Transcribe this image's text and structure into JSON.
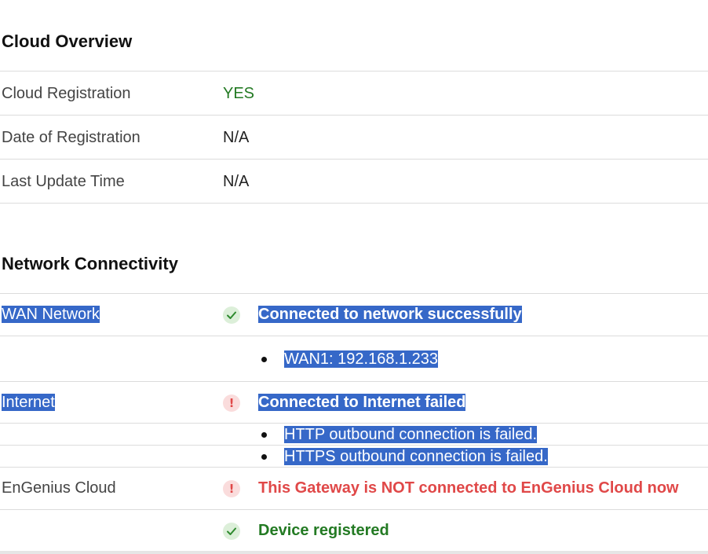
{
  "cloud_overview": {
    "title": "Cloud Overview",
    "rows": [
      {
        "label": "Cloud Registration",
        "value": "YES",
        "value_color": "#237a23"
      },
      {
        "label": "Date of Registration",
        "value": "N/A"
      },
      {
        "label": "Last Update Time",
        "value": "N/A"
      }
    ]
  },
  "network_connectivity": {
    "title": "Network Connectivity",
    "wan": {
      "label": "WAN Network",
      "status": "ok",
      "status_icon": "check-icon",
      "status_text": "Connected to network successfully",
      "details": [
        "WAN1: 192.168.1.233"
      ]
    },
    "internet": {
      "label": "Internet",
      "status": "error",
      "status_icon": "exclamation-icon",
      "status_text": "Connected to Internet failed",
      "details": [
        "HTTP outbound connection is failed.",
        "HTTPS outbound connection is failed."
      ]
    },
    "engenius_cloud": {
      "label": "EnGenius Cloud",
      "status": "error",
      "status_icon": "exclamation-icon",
      "status_text": "This Gateway is NOT connected to EnGenius Cloud now",
      "status_color": "#e04848"
    },
    "device": {
      "status": "ok",
      "status_icon": "check-icon",
      "status_text": "Device registered",
      "status_color": "#237a23"
    }
  },
  "colors": {
    "selection_highlight": "#3668c8",
    "success": "#237a23",
    "error": "#e04848"
  }
}
